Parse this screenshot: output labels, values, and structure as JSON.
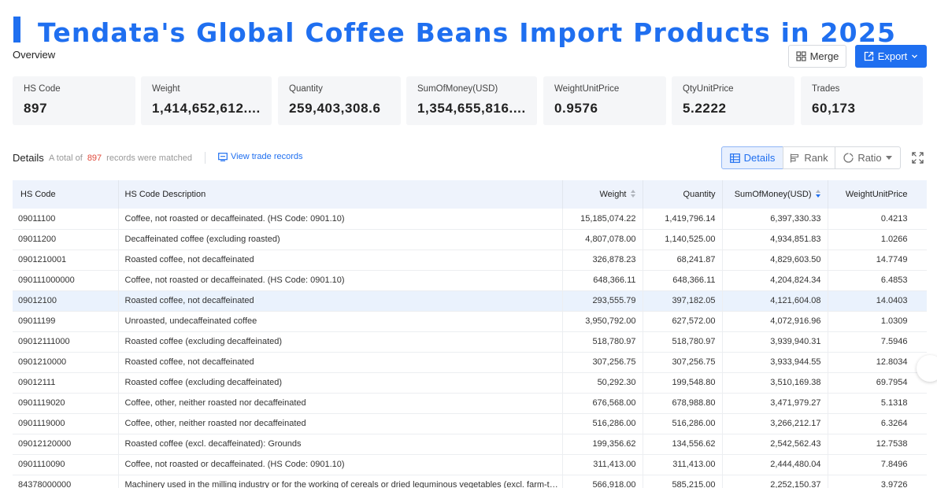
{
  "title": "Tendata's Global Coffee Beans Import Products in 2025",
  "overview_label": "Overview",
  "actions": {
    "merge_label": "Merge",
    "export_label": "Export"
  },
  "stats": [
    {
      "label": "HS Code",
      "value": "897"
    },
    {
      "label": "Weight",
      "value": "1,414,652,612...."
    },
    {
      "label": "Quantity",
      "value": "259,403,308.6"
    },
    {
      "label": "SumOfMoney(USD)",
      "value": "1,354,655,816...."
    },
    {
      "label": "WeightUnitPrice",
      "value": "0.9576"
    },
    {
      "label": "QtyUnitPrice",
      "value": "5.2222"
    },
    {
      "label": "Trades",
      "value": "60,173"
    }
  ],
  "details": {
    "title": "Details",
    "summary_prefix": "A total of",
    "count": "897",
    "summary_suffix": "records were matched",
    "view_trade_label": "View trade records"
  },
  "view_tabs": {
    "details": "Details",
    "rank": "Rank",
    "ratio": "Ratio"
  },
  "table": {
    "columns": [
      "HS Code",
      "HS Code Description",
      "Weight",
      "Quantity",
      "SumOfMoney(USD)",
      "WeightUnitPrice"
    ],
    "rows": [
      [
        "09011100",
        "Coffee, not roasted or decaffeinated. (HS Code: 0901.10)",
        "15,185,074.22",
        "1,419,796.14",
        "6,397,330.33",
        "0.4213"
      ],
      [
        "09011200",
        "Decaffeinated coffee (excluding roasted)",
        "4,807,078.00",
        "1,140,525.00",
        "4,934,851.83",
        "1.0266"
      ],
      [
        "0901210001",
        "Roasted coffee, not decaffeinated",
        "326,878.23",
        "68,241.87",
        "4,829,603.50",
        "14.7749"
      ],
      [
        "090111000000",
        "Coffee, not roasted or decaffeinated. (HS Code: 0901.10)",
        "648,366.11",
        "648,366.11",
        "4,204,824.34",
        "6.4853"
      ],
      [
        "09012100",
        "Roasted coffee, not decaffeinated",
        "293,555.79",
        "397,182.05",
        "4,121,604.08",
        "14.0403"
      ],
      [
        "09011199",
        "Unroasted, undecaffeinated coffee",
        "3,950,792.00",
        "627,572.00",
        "4,072,916.96",
        "1.0309"
      ],
      [
        "09012111000",
        "Roasted coffee (excluding decaffeinated)",
        "518,780.97",
        "518,780.97",
        "3,939,940.31",
        "7.5946"
      ],
      [
        "0901210000",
        "Roasted coffee, not decaffeinated",
        "307,256.75",
        "307,256.75",
        "3,933,944.55",
        "12.8034"
      ],
      [
        "09012111",
        "Roasted coffee (excluding decaffeinated)",
        "50,292.30",
        "199,548.80",
        "3,510,169.38",
        "69.7954"
      ],
      [
        "0901119020",
        "Coffee, other, neither roasted nor decaffeinated",
        "676,568.00",
        "678,988.80",
        "3,471,979.27",
        "5.1318"
      ],
      [
        "0901119000",
        "Coffee, other, neither roasted nor decaffeinated",
        "516,286.00",
        "516,286.00",
        "3,266,212.17",
        "6.3264"
      ],
      [
        "09012120000",
        "Roasted coffee (excl. decaffeinated): Grounds",
        "199,356.62",
        "134,556.62",
        "2,542,562.43",
        "12.7538"
      ],
      [
        "0901110090",
        "Coffee, not roasted or decaffeinated. (HS Code: 0901.10)",
        "311,413.00",
        "311,413.00",
        "2,444,480.04",
        "7.8496"
      ],
      [
        "84378000000",
        "Machinery used in the milling industry or for the working of cereals or dried leguminous vegetables (excl. farm-type machinery)",
        "566,918.00",
        "585,215.00",
        "2,252,150.37",
        "3.9726"
      ]
    ],
    "highlighted_row": 4
  },
  "colors": {
    "accent": "#1f6ff0",
    "count": "#e04a3c",
    "header_bg": "#eef3fc",
    "highlight_row": "#eaf2fd",
    "card_bg": "#f5f6f8"
  }
}
